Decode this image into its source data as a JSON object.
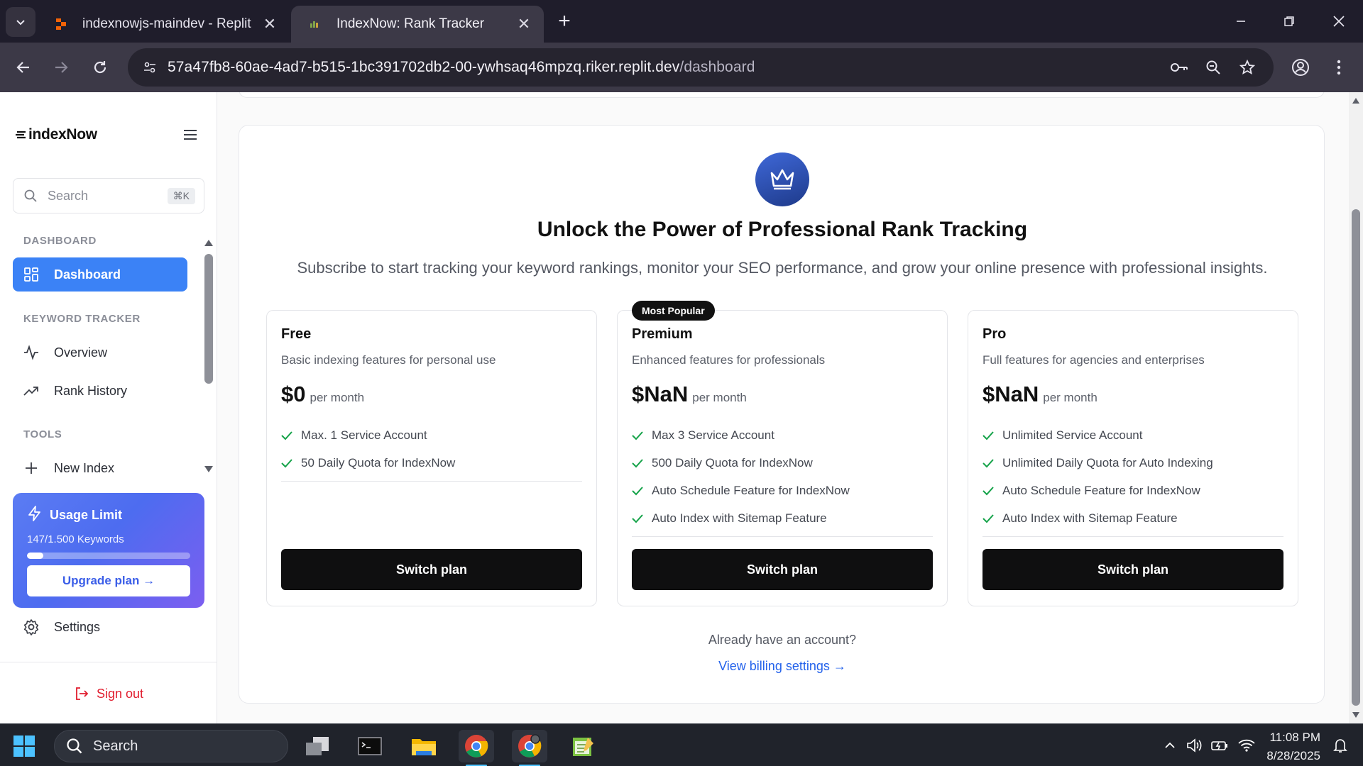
{
  "browser": {
    "tabs": [
      {
        "title": "indexnowjs-maindev - Replit"
      },
      {
        "title": "IndexNow: Rank Tracker"
      }
    ],
    "address": {
      "host": "57a47fb8-60ae-4ad7-b515-1bc391702db2-00-ywhsaq46mpzq.riker.replit.dev",
      "path": "/dashboard"
    }
  },
  "sidebar": {
    "logo": "indexNow",
    "search": {
      "placeholder": "Search",
      "shortcut": "⌘K"
    },
    "sections": [
      {
        "title": "DASHBOARD",
        "items": [
          {
            "label": "Dashboard",
            "icon": "grid-icon",
            "active": true
          }
        ]
      },
      {
        "title": "KEYWORD TRACKER",
        "items": [
          {
            "label": "Overview",
            "icon": "activity-icon"
          },
          {
            "label": "Rank History",
            "icon": "trending-up-icon"
          }
        ]
      },
      {
        "title": "TOOLS",
        "items": [
          {
            "label": "New Index",
            "icon": "plus-icon"
          }
        ]
      }
    ],
    "usage": {
      "title": "Usage Limit",
      "count_text": "147/1.500 Keywords",
      "progress_fraction": 0.098,
      "upgrade_label": "Upgrade plan →"
    },
    "settings_label": "Settings",
    "signout_label": "Sign out"
  },
  "main": {
    "headline": "Unlock the Power of Professional Rank Tracking",
    "subline": "Subscribe to start tracking your keyword rankings, monitor your SEO performance, and grow your online presence with professional insights.",
    "plans": [
      {
        "name": "Free",
        "description": "Basic indexing features for personal use",
        "price": "$0",
        "period": "per month",
        "features": [
          "Max. 1 Service Account",
          "50 Daily Quota for IndexNow"
        ],
        "button": "Switch plan"
      },
      {
        "name": "Premium",
        "badge": "Most Popular",
        "description": "Enhanced features for professionals",
        "price": "$NaN",
        "period": "per month",
        "features": [
          "Max 3 Service Account",
          "500 Daily Quota for IndexNow",
          "Auto Schedule Feature for IndexNow",
          "Auto Index with Sitemap Feature"
        ],
        "button": "Switch plan"
      },
      {
        "name": "Pro",
        "description": "Full features for agencies and enterprises",
        "price": "$NaN",
        "period": "per month",
        "features": [
          "Unlimited Service Account",
          "Unlimited Daily Quota for Auto Indexing",
          "Auto Schedule Feature for IndexNow",
          "Auto Index with Sitemap Feature"
        ],
        "button": "Switch plan"
      }
    ],
    "already_text": "Already have an account?",
    "billing_link": "View billing settings →"
  },
  "taskbar": {
    "search_label": "Search",
    "time": "11:08 PM",
    "date": "8/28/2025"
  },
  "colors": {
    "accent": "#3b82f6",
    "check": "#16a34a",
    "signout": "#e11d2e",
    "link": "#2563eb"
  }
}
